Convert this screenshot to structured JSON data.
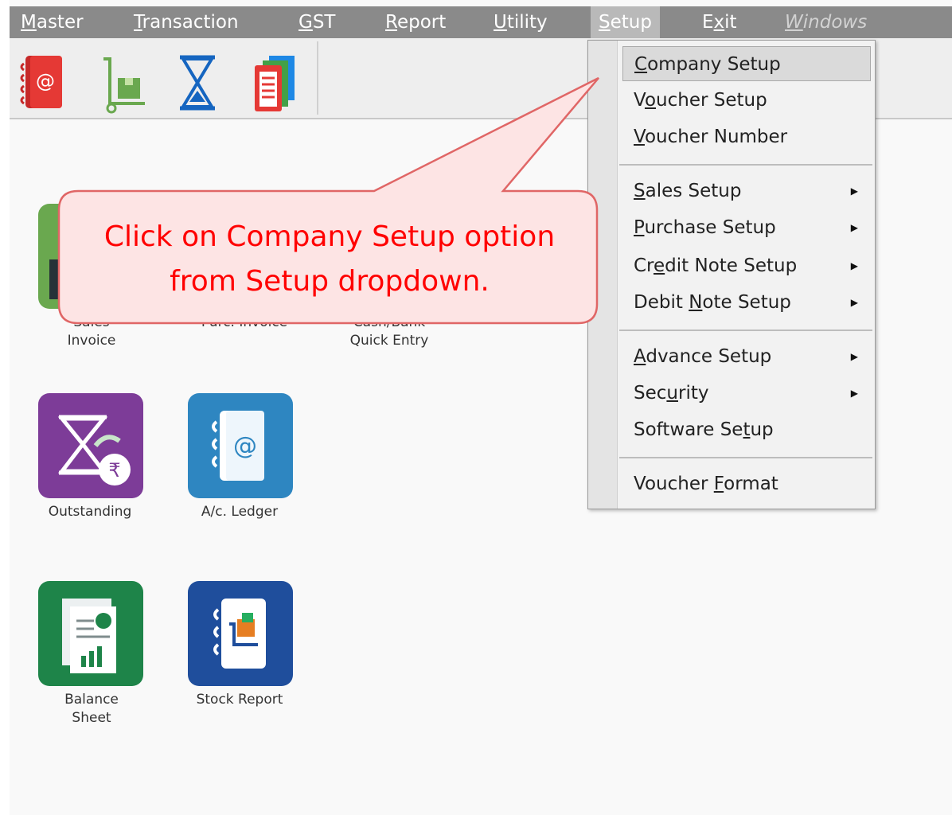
{
  "menubar": {
    "items": [
      {
        "pre": "",
        "u": "M",
        "post": "aster"
      },
      {
        "pre": "",
        "u": "T",
        "post": "ransaction"
      },
      {
        "pre": "",
        "u": "G",
        "post": "ST"
      },
      {
        "pre": "",
        "u": "R",
        "post": "eport"
      },
      {
        "pre": "",
        "u": "U",
        "post": "tility"
      },
      {
        "pre": "",
        "u": "S",
        "post": "etup"
      },
      {
        "pre": "E",
        "u": "x",
        "post": "it"
      },
      {
        "pre": "",
        "u": "W",
        "post": "indows"
      }
    ]
  },
  "toolbar": {
    "icons": [
      "ledger-book-icon",
      "stock-trolley-icon",
      "hourglass-icon",
      "report-stack-icon"
    ]
  },
  "tiles": [
    {
      "label": "Sales\nInvoice",
      "color": "#6aa84f",
      "icon": "sales-invoice-icon"
    },
    {
      "label": "Purc. Invoice",
      "color": "#c0392b",
      "icon": "purchase-invoice-icon"
    },
    {
      "label": "Cash/Bank\nQuick Entry",
      "color": "#2e86c1",
      "icon": "cash-bank-icon"
    },
    {
      "label": "Outstanding",
      "color": "#7d3c98",
      "icon": "outstanding-icon"
    },
    {
      "label": "A/c. Ledger",
      "color": "#2e86c1",
      "icon": "ledger-icon"
    },
    {
      "label": "Balance\nSheet",
      "color": "#1e8449",
      "icon": "balance-sheet-icon"
    },
    {
      "label": "Stock Report",
      "color": "#1f4e9c",
      "icon": "stock-report-icon"
    }
  ],
  "setup_menu": {
    "items": [
      {
        "pre": "",
        "u": "C",
        "post": "ompany Setup",
        "submenu": false
      },
      {
        "pre": "V",
        "u": "o",
        "post": "ucher Setup",
        "submenu": false
      },
      {
        "pre": "",
        "u": "V",
        "post": "oucher Number",
        "submenu": false
      },
      {
        "pre": "",
        "u": "S",
        "post": "ales Setup",
        "submenu": true
      },
      {
        "pre": "",
        "u": "P",
        "post": "urchase Setup",
        "submenu": true
      },
      {
        "pre": "Cr",
        "u": "e",
        "post": "dit Note Setup",
        "submenu": true
      },
      {
        "pre": "Debit ",
        "u": "N",
        "post": "ote Setup",
        "submenu": true
      },
      {
        "pre": "",
        "u": "A",
        "post": "dvance Setup",
        "submenu": true
      },
      {
        "pre": "Sec",
        "u": "u",
        "post": "rity",
        "submenu": true
      },
      {
        "pre": "Software Se",
        "u": "t",
        "post": "up",
        "submenu": false
      },
      {
        "pre": "Voucher ",
        "u": "F",
        "post": "ormat",
        "submenu": false
      }
    ]
  },
  "callout": {
    "line1": "Click on Company Setup option",
    "line2": "from Setup dropdown."
  },
  "colors": {
    "menubar": "#8a8a8a",
    "callout_fill": "#fde4e4",
    "callout_border": "#e06666",
    "callout_text": "#ff0000"
  }
}
